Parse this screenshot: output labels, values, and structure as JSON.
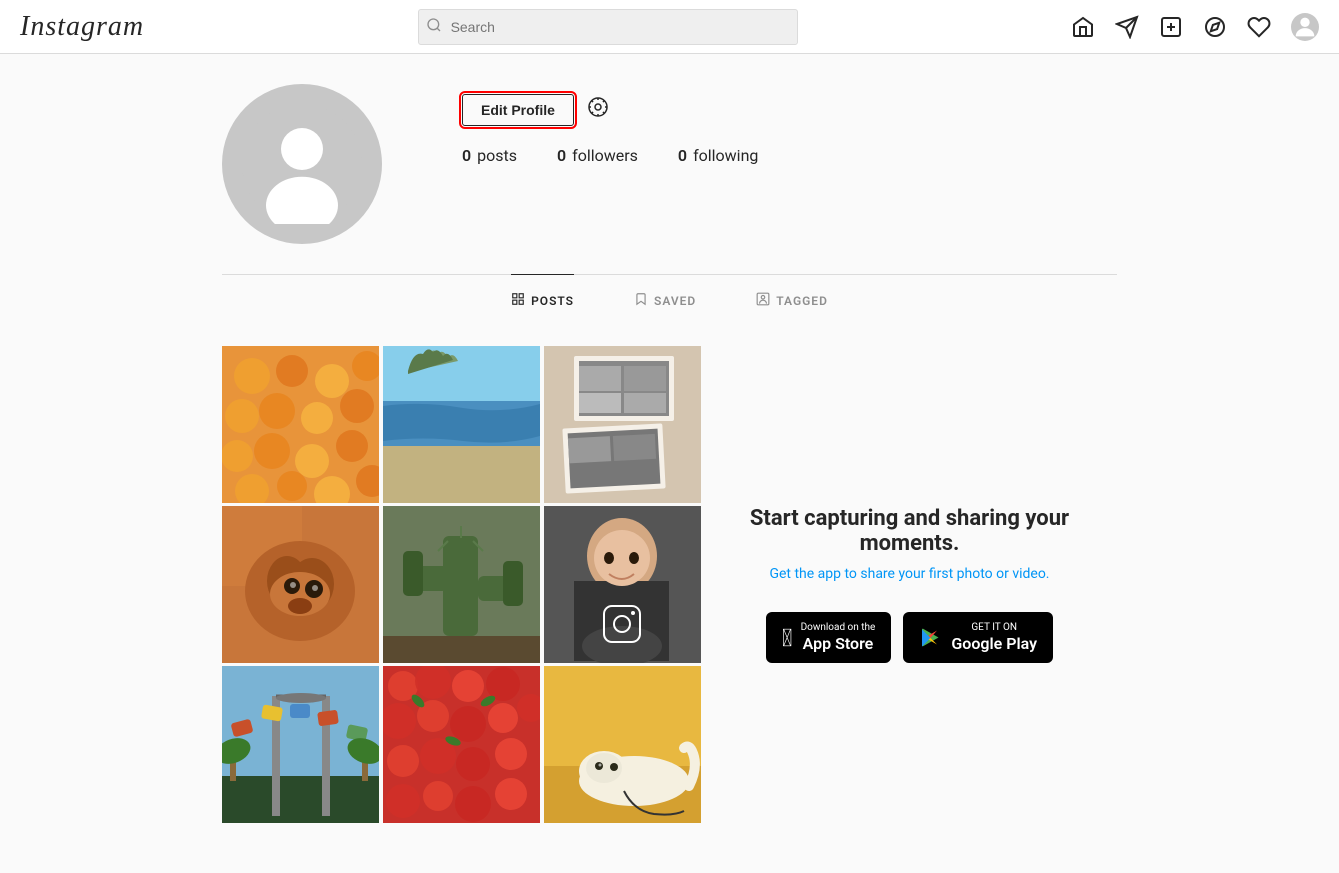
{
  "header": {
    "logo": "Instagram",
    "search_placeholder": "Search",
    "nav_icons": [
      "home",
      "direct",
      "new-post",
      "explore",
      "activity"
    ]
  },
  "profile": {
    "edit_button_label": "Edit Profile",
    "stats": {
      "posts_count": "0",
      "posts_label": "posts",
      "followers_count": "0",
      "followers_label": "followers",
      "following_count": "0",
      "following_label": "following"
    }
  },
  "tabs": [
    {
      "id": "posts",
      "label": "POSTS",
      "active": true
    },
    {
      "id": "saved",
      "label": "SAVED",
      "active": false
    },
    {
      "id": "tagged",
      "label": "TAGGED",
      "active": false
    }
  ],
  "cta": {
    "title": "Start capturing and sharing your moments.",
    "subtitle": "Get the app to share your first photo or video.",
    "app_store_line1": "Download on the",
    "app_store_line2": "App Store",
    "google_play_line1": "GET IT ON",
    "google_play_line2": "Google Play"
  }
}
